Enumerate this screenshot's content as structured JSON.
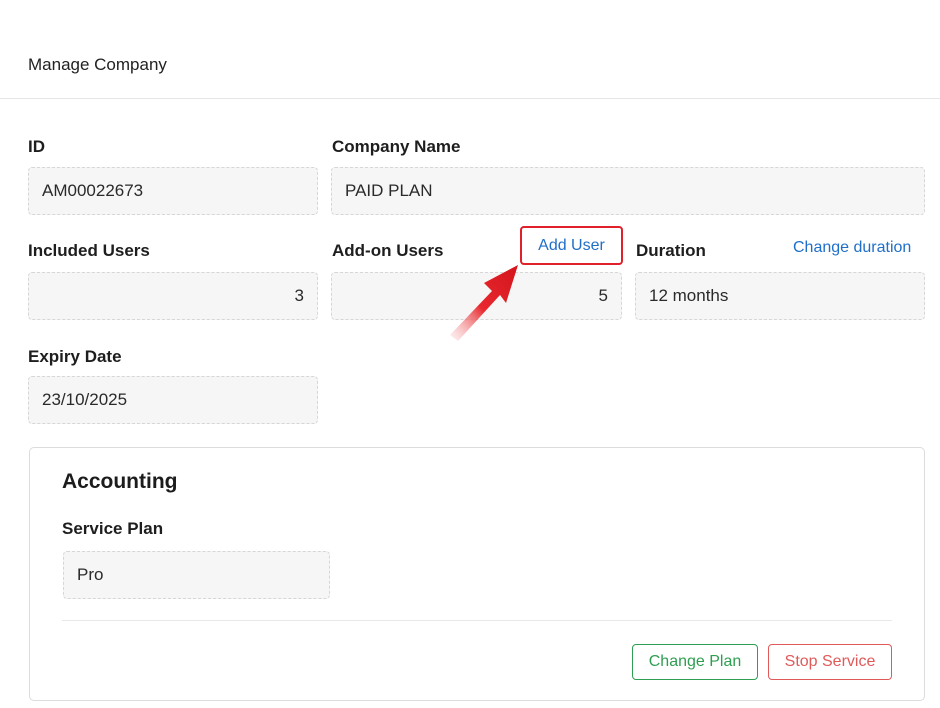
{
  "header": {
    "title": "Manage Company"
  },
  "fields": {
    "id": {
      "label": "ID",
      "value": "AM00022673"
    },
    "company_name": {
      "label": "Company Name",
      "value": "PAID PLAN"
    },
    "included_users": {
      "label": "Included Users",
      "value": "3"
    },
    "addon_users": {
      "label": "Add-on Users",
      "value": "5",
      "action": "Add User"
    },
    "duration": {
      "label": "Duration",
      "value": "12 months",
      "action": "Change duration"
    },
    "expiry_date": {
      "label": "Expiry Date",
      "value": "23/10/2025"
    }
  },
  "accounting": {
    "title": "Accounting",
    "service_plan_label": "Service Plan",
    "service_plan_value": "Pro",
    "change_plan": "Change Plan",
    "stop_service": "Stop Service"
  },
  "colors": {
    "link": "#1f6fc9",
    "highlight": "#e0202a",
    "change_plan": "#2e9e52",
    "stop_service": "#e05a5a"
  }
}
